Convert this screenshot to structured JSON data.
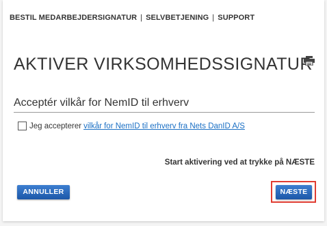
{
  "nav": {
    "items": [
      {
        "label": "BESTIL MEDARBEJDERSIGNATUR"
      },
      {
        "label": "SELVBETJENING"
      },
      {
        "label": "SUPPORT"
      }
    ],
    "separator": "|"
  },
  "page": {
    "title": "AKTIVER VIRKSOMHEDSSIGNATUR",
    "print_icon": "printer-icon"
  },
  "terms": {
    "heading": "Acceptér vilkår for NemID til erhverv",
    "checkbox_checked": false,
    "accept_label": "Jeg accepterer",
    "link_text": "vilkår for NemID til erhverv fra Nets DanID A/S"
  },
  "hint": "Start aktivering ved at trykke på NÆSTE",
  "buttons": {
    "cancel": "ANNULLER",
    "next": "NÆSTE"
  },
  "colors": {
    "button_blue": "#1c57a8",
    "link_blue": "#1a6fc4",
    "highlight_red": "#e03c31"
  }
}
